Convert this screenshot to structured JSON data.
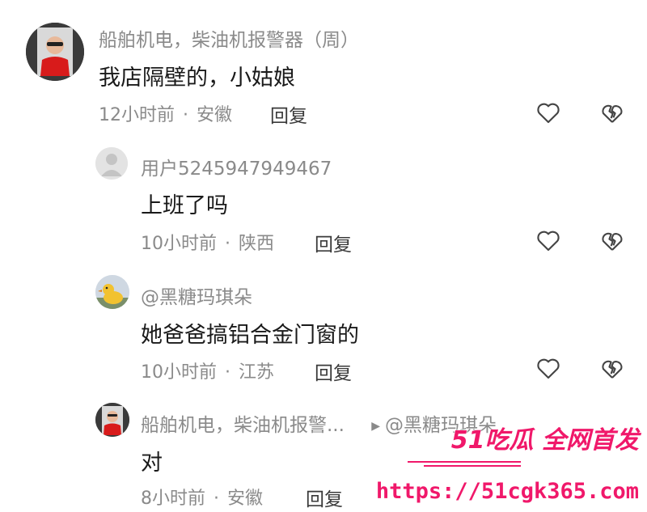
{
  "colors": {
    "username": "#8a8a8a",
    "text": "#1a1a1a",
    "meta": "#8a8a8a",
    "watermark": "#f0186a"
  },
  "comments": [
    {
      "username": "船舶机电，柴油机报警器（周）",
      "text": "我店隔壁的，小姑娘",
      "time": "12小时前",
      "location": "安徽",
      "reply_label": "回复",
      "like_icon": "heart-outline-icon",
      "dislike_icon": "broken-heart-icon"
    },
    {
      "username": "用户5245947949467",
      "text": "上班了吗",
      "time": "10小时前",
      "location": "陕西",
      "reply_label": "回复",
      "like_icon": "heart-outline-icon",
      "dislike_icon": "broken-heart-icon"
    },
    {
      "username": "@黑糖玛琪朵",
      "text": "她爸爸搞铝合金门窗的",
      "time": "10小时前",
      "location": "江苏",
      "reply_label": "回复",
      "like_icon": "heart-outline-icon",
      "dislike_icon": "broken-heart-icon"
    },
    {
      "username": "船舶机电，柴油机报警...",
      "reply_to": "@黑糖玛琪朵",
      "text": "对",
      "time": "8小时前",
      "location": "安徽",
      "reply_label": "回复"
    }
  ],
  "watermark": {
    "brand": "51吃瓜 全网首发",
    "url": "https://51cgk365.com"
  }
}
